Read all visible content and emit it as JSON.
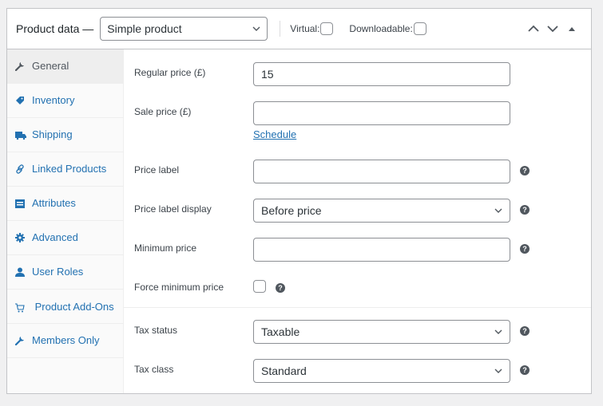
{
  "header": {
    "title": "Product data —",
    "product_type": "Simple product",
    "virtual_label": "Virtual:",
    "downloadable_label": "Downloadable:",
    "virtual_checked": false,
    "downloadable_checked": false
  },
  "sidebar": {
    "items": [
      {
        "label": "General",
        "icon": "wrench-icon",
        "active": true
      },
      {
        "label": "Inventory",
        "icon": "tag-icon",
        "active": false
      },
      {
        "label": "Shipping",
        "icon": "truck-icon",
        "active": false
      },
      {
        "label": "Linked Products",
        "icon": "link-icon",
        "active": false
      },
      {
        "label": "Attributes",
        "icon": "list-card-icon",
        "active": false
      },
      {
        "label": "Advanced",
        "icon": "gear-icon",
        "active": false
      },
      {
        "label": "User Roles",
        "icon": "user-icon",
        "active": false
      },
      {
        "label": "Product Add-Ons",
        "icon": "cart-icon",
        "active": false
      },
      {
        "label": "Members Only",
        "icon": "wrench-icon",
        "active": false
      }
    ]
  },
  "form": {
    "regular_price": {
      "label": "Regular price (£)",
      "value": "15"
    },
    "sale_price": {
      "label": "Sale price (£)",
      "value": ""
    },
    "schedule_link": "Schedule",
    "price_label": {
      "label": "Price label",
      "value": ""
    },
    "price_label_display": {
      "label": "Price label display",
      "value": "Before price"
    },
    "minimum_price": {
      "label": "Minimum price",
      "value": ""
    },
    "force_minimum_price": {
      "label": "Force minimum price",
      "checked": false
    },
    "tax_status": {
      "label": "Tax status",
      "value": "Taxable"
    },
    "tax_class": {
      "label": "Tax class",
      "value": "Standard"
    },
    "help_glyph": "?"
  },
  "colors": {
    "link": "#2271b1",
    "border": "#8c8f94",
    "panel_border": "#c3c4c7"
  }
}
